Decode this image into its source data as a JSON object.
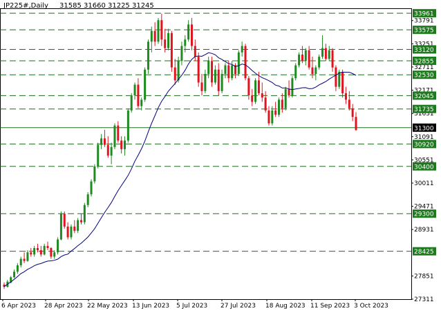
{
  "chart_data": {
    "type": "candlestick",
    "header": {
      "symbol": "JP225#,Daily",
      "ohlc": "31585 31660 31225 31245"
    },
    "colors": {
      "background": "#ffffff",
      "bull": "#1f8a1f",
      "bear": "#e0141e",
      "ma_line": "#000080",
      "level_line": "#1f6b1f",
      "level_box": "#1f7a1f",
      "price_box": "#000000",
      "axis": "#000000"
    },
    "y_range": [
      27311,
      34060
    ],
    "y_tick_labels": [
      "33791",
      "33251",
      "32711",
      "32171",
      "31631",
      "31091",
      "30551",
      "30011",
      "29471",
      "28931",
      "27851",
      "27311"
    ],
    "level_labels": [
      "33961",
      "33575",
      "33120",
      "32855",
      "32530",
      "32045",
      "31735",
      "30920",
      "30400",
      "29300",
      "28425"
    ],
    "current_price": "31300",
    "x_labels": [
      "6 Apr 2023",
      "28 Apr 2023",
      "22 May 2023",
      "13 Jun 2023",
      "5 Jul 2023",
      "27 Jul 2023",
      "18 Aug 2023",
      "11 Sep 2023",
      "3 Oct 2023"
    ],
    "candles": [
      [
        27650,
        27700,
        27550,
        27600
      ],
      [
        27600,
        27760,
        27580,
        27720
      ],
      [
        27700,
        27850,
        27680,
        27820
      ],
      [
        27820,
        28000,
        27800,
        27950
      ],
      [
        27950,
        28150,
        27900,
        28100
      ],
      [
        28100,
        28300,
        28050,
        28250
      ],
      [
        28250,
        28400,
        28150,
        28200
      ],
      [
        28200,
        28450,
        28180,
        28400
      ],
      [
        28400,
        28500,
        28300,
        28350
      ],
      [
        28350,
        28550,
        28300,
        28500
      ],
      [
        28500,
        28600,
        28400,
        28450
      ],
      [
        28450,
        28550,
        28300,
        28350
      ],
      [
        28350,
        28600,
        28330,
        28550
      ],
      [
        28550,
        28650,
        28450,
        28500
      ],
      [
        28500,
        28520,
        28250,
        28300
      ],
      [
        28300,
        28450,
        28250,
        28400
      ],
      [
        28400,
        28750,
        28350,
        28700
      ],
      [
        28700,
        29350,
        28680,
        29300
      ],
      [
        29300,
        29350,
        28950,
        29000
      ],
      [
        29000,
        29100,
        28700,
        28750
      ],
      [
        28750,
        29050,
        28700,
        29000
      ],
      [
        29000,
        29150,
        28850,
        28900
      ],
      [
        28900,
        29200,
        28850,
        29150
      ],
      [
        29150,
        29300,
        29050,
        29100
      ],
      [
        29100,
        29550,
        29050,
        29500
      ],
      [
        29500,
        29800,
        29450,
        29750
      ],
      [
        29750,
        30100,
        29700,
        30050
      ],
      [
        30050,
        30450,
        30000,
        30400
      ],
      [
        30400,
        30950,
        30350,
        30900
      ],
      [
        30900,
        31150,
        30800,
        31050
      ],
      [
        31050,
        31250,
        30850,
        30900
      ],
      [
        30900,
        31100,
        30600,
        30650
      ],
      [
        30650,
        30950,
        30450,
        30850
      ],
      [
        30850,
        31400,
        30800,
        31350
      ],
      [
        31350,
        31450,
        30950,
        31000
      ],
      [
        31000,
        31100,
        30700,
        30800
      ],
      [
        30800,
        31100,
        30650,
        31000
      ],
      [
        31000,
        31750,
        30950,
        31700
      ],
      [
        31700,
        32100,
        31650,
        32050
      ],
      [
        32050,
        32350,
        31950,
        32300
      ],
      [
        32300,
        32450,
        31750,
        31800
      ],
      [
        31800,
        32000,
        31700,
        31950
      ],
      [
        31950,
        32700,
        31900,
        32650
      ],
      [
        32650,
        33350,
        32550,
        33300
      ],
      [
        33300,
        33650,
        33050,
        33550
      ],
      [
        33550,
        33750,
        33200,
        33300
      ],
      [
        33300,
        33850,
        33250,
        33800
      ],
      [
        33800,
        33950,
        33200,
        33350
      ],
      [
        33350,
        33600,
        33050,
        33150
      ],
      [
        33150,
        33600,
        33100,
        33500
      ],
      [
        33500,
        33550,
        32600,
        32700
      ],
      [
        32700,
        32900,
        32300,
        32400
      ],
      [
        32400,
        32950,
        32350,
        32850
      ],
      [
        32850,
        33300,
        32750,
        33200
      ],
      [
        33200,
        33450,
        33050,
        33350
      ],
      [
        33350,
        33800,
        33300,
        33700
      ],
      [
        33700,
        33850,
        33100,
        33200
      ],
      [
        33200,
        33350,
        32850,
        32950
      ],
      [
        32950,
        33050,
        32250,
        32350
      ],
      [
        32350,
        32550,
        32050,
        32150
      ],
      [
        32150,
        32650,
        32100,
        32550
      ],
      [
        32550,
        32950,
        32450,
        32850
      ],
      [
        32850,
        32950,
        32250,
        32350
      ],
      [
        32350,
        32750,
        32300,
        32650
      ],
      [
        32650,
        32800,
        32050,
        32150
      ],
      [
        32150,
        32650,
        32100,
        32550
      ],
      [
        32550,
        32800,
        32450,
        32750
      ],
      [
        32750,
        32850,
        32350,
        32450
      ],
      [
        32450,
        32850,
        32400,
        32750
      ],
      [
        32750,
        32800,
        32450,
        32550
      ],
      [
        32550,
        33100,
        32500,
        33050
      ],
      [
        33050,
        33300,
        32950,
        33200
      ],
      [
        33200,
        33250,
        32400,
        32450
      ],
      [
        32450,
        32500,
        31950,
        32050
      ],
      [
        32050,
        32200,
        31800,
        31900
      ],
      [
        31900,
        32450,
        31850,
        32400
      ],
      [
        32400,
        32600,
        32050,
        32100
      ],
      [
        32100,
        32350,
        31900,
        32000
      ],
      [
        32000,
        32150,
        31650,
        31700
      ],
      [
        31700,
        31800,
        31350,
        31400
      ],
      [
        31400,
        31800,
        31350,
        31700
      ],
      [
        31700,
        31900,
        31550,
        31600
      ],
      [
        31600,
        32000,
        31550,
        31950
      ],
      [
        31950,
        32100,
        31650,
        31750
      ],
      [
        31750,
        32250,
        31700,
        32200
      ],
      [
        32200,
        32400,
        32000,
        32050
      ],
      [
        32050,
        32500,
        32000,
        32450
      ],
      [
        32450,
        32800,
        32400,
        32750
      ],
      [
        32750,
        33050,
        32700,
        33000
      ],
      [
        33000,
        33200,
        32800,
        32850
      ],
      [
        32850,
        33150,
        32750,
        33100
      ],
      [
        33100,
        33200,
        32650,
        32700
      ],
      [
        32700,
        32950,
        32450,
        32550
      ],
      [
        32550,
        32750,
        32400,
        32700
      ],
      [
        32700,
        33000,
        32650,
        32950
      ],
      [
        32950,
        33450,
        32900,
        33150
      ],
      [
        33150,
        33250,
        32850,
        32900
      ],
      [
        32900,
        33200,
        32850,
        33100
      ],
      [
        33100,
        33150,
        32600,
        32700
      ],
      [
        32700,
        32750,
        32150,
        32250
      ],
      [
        32250,
        32650,
        32200,
        32600
      ],
      [
        32600,
        32650,
        32000,
        32100
      ],
      [
        32100,
        32250,
        31850,
        31950
      ],
      [
        31950,
        32150,
        31700,
        31750
      ],
      [
        31750,
        31850,
        31450,
        31550
      ],
      [
        31550,
        31660,
        31225,
        31245
      ]
    ],
    "ma_period": 20
  }
}
